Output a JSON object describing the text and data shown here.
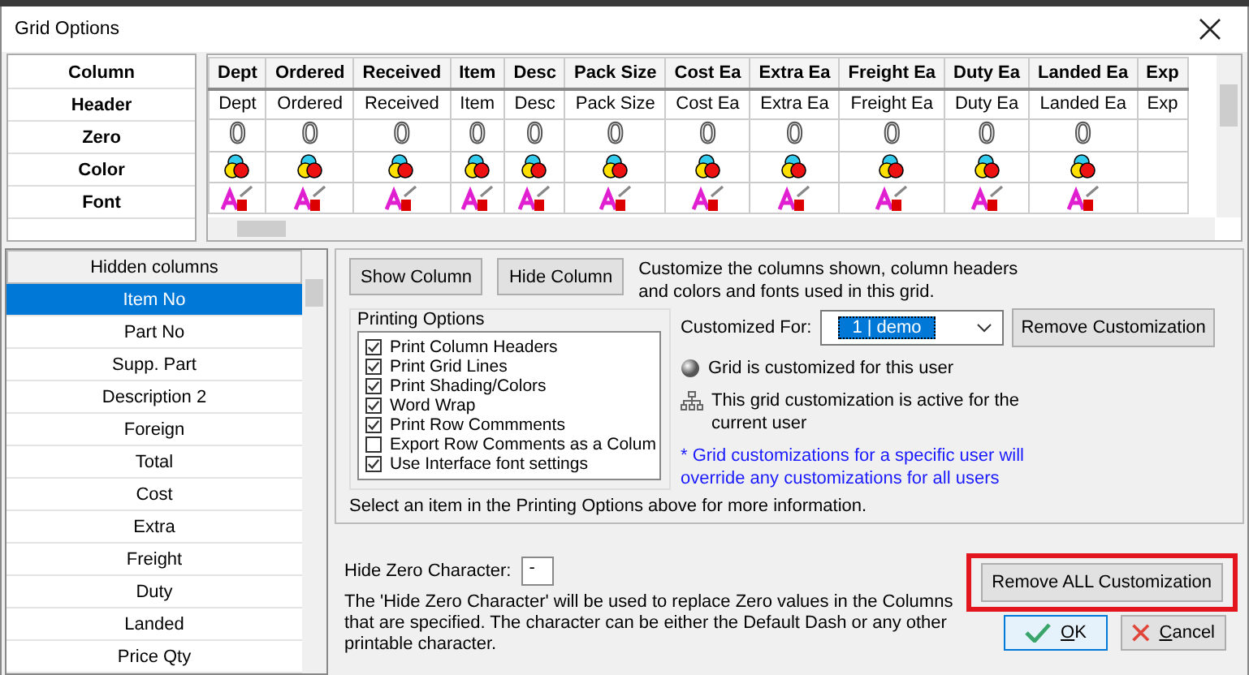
{
  "window": {
    "title": "Grid Options"
  },
  "grid": {
    "row_labels": [
      "Column",
      "Header",
      "Zero",
      "Color",
      "Font"
    ],
    "columns": [
      {
        "name": "Dept",
        "header": "Dept",
        "zero": "0"
      },
      {
        "name": "Ordered",
        "header": "Ordered",
        "zero": "0"
      },
      {
        "name": "Received",
        "header": "Received",
        "zero": "0"
      },
      {
        "name": "Item",
        "header": "Item",
        "zero": "0"
      },
      {
        "name": "Desc",
        "header": "Desc",
        "zero": "0"
      },
      {
        "name": "Pack Size",
        "header": "Pack Size",
        "zero": "0"
      },
      {
        "name": "Cost Ea",
        "header": "Cost Ea",
        "zero": "0"
      },
      {
        "name": "Extra Ea",
        "header": "Extra Ea",
        "zero": "0"
      },
      {
        "name": "Freight Ea",
        "header": "Freight Ea",
        "zero": "0"
      },
      {
        "name": "Duty Ea",
        "header": "Duty Ea",
        "zero": "0"
      },
      {
        "name": "Landed Ea",
        "header": "Landed Ea",
        "zero": "0"
      },
      {
        "name": "Exp",
        "header": "Exp"
      }
    ]
  },
  "hidden_columns": {
    "heading": "Hidden columns",
    "items": [
      {
        "label": "Item No",
        "selected": true
      },
      {
        "label": "Part No",
        "selected": false
      },
      {
        "label": "Supp. Part",
        "selected": false
      },
      {
        "label": "Description 2",
        "selected": false
      },
      {
        "label": "Foreign",
        "selected": false
      },
      {
        "label": "Total",
        "selected": false
      },
      {
        "label": "Cost",
        "selected": false
      },
      {
        "label": "Extra",
        "selected": false
      },
      {
        "label": "Freight",
        "selected": false
      },
      {
        "label": "Duty",
        "selected": false
      },
      {
        "label": "Landed",
        "selected": false
      },
      {
        "label": "Price Qty",
        "selected": false
      }
    ]
  },
  "buttons": [
    "Show Column",
    "Hide Column"
  ],
  "intro": "Customize the columns shown, column headers and colors and fonts used in this grid.",
  "printing_options": {
    "title": "Printing Options",
    "items": [
      {
        "label": "Print Column Headers",
        "checked": true
      },
      {
        "label": "Print Grid Lines",
        "checked": true
      },
      {
        "label": "Print Shading/Colors",
        "checked": true
      },
      {
        "label": "Word Wrap",
        "checked": true
      },
      {
        "label": "Print Row Commments",
        "checked": true
      },
      {
        "label": "Export Row Comments as a Colum",
        "checked": false
      },
      {
        "label": "Use Interface font settings",
        "checked": true
      }
    ]
  },
  "customized_for": {
    "label": "Customized For:",
    "value": "1 | demo",
    "remove_button": "Remove Customization"
  },
  "status_lines": [
    "Grid is customized for this user",
    "This grid customization is active for the current user"
  ],
  "note": "* Grid customizations for a specific user will override any customizations for all users",
  "info": "Select an item in the Printing Options above for more information.",
  "hide_zero": {
    "label": "Hide Zero Character:",
    "value": "-",
    "description": "The 'Hide Zero Character' will be used to replace Zero values in the Columns that are specified. The character can be either the Default Dash or any other printable character."
  },
  "remove_all_button": "Remove ALL Customization",
  "ok_button": "OK",
  "cancel_button": "Cancel"
}
